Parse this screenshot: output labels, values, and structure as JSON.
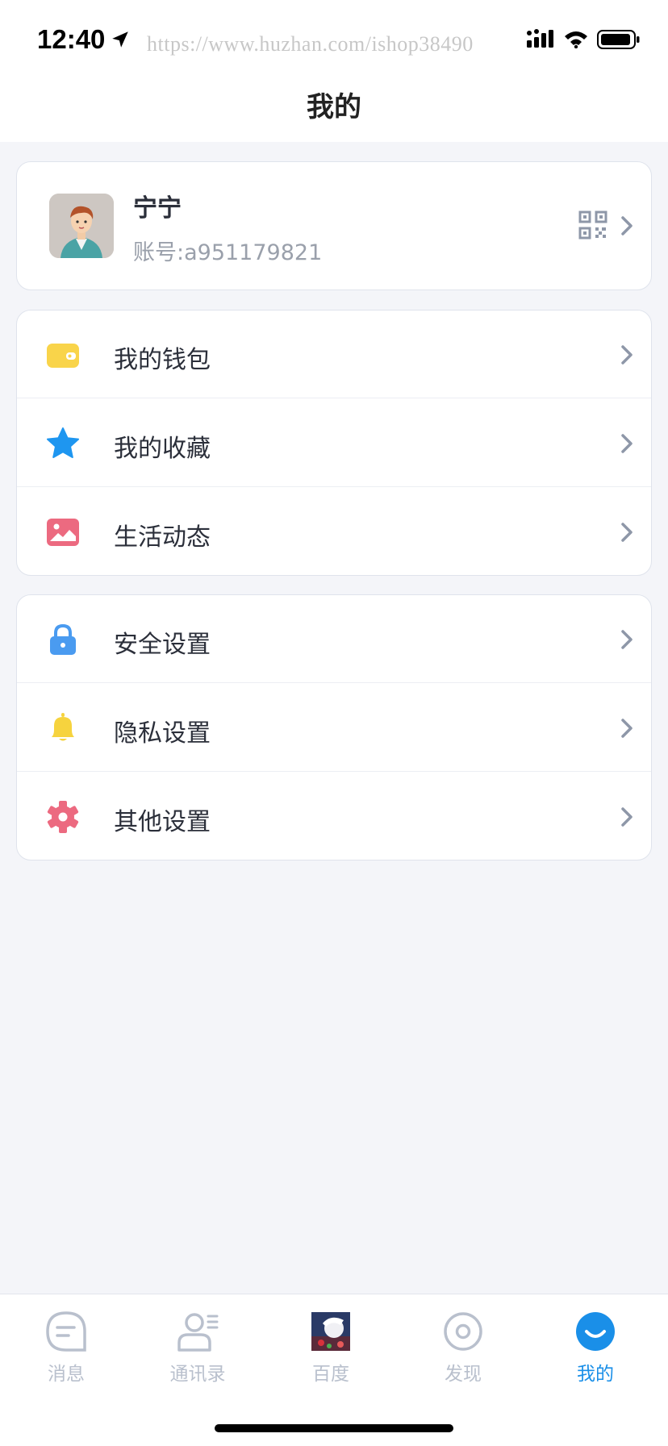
{
  "status_bar": {
    "time": "12:40",
    "watermark": "https://www.huzhan.com/ishop38490"
  },
  "header": {
    "title": "我的"
  },
  "profile": {
    "name": "宁宁",
    "account": "账号:a951179821",
    "icons": [
      "avatar",
      "qr-code-icon",
      "chevron-right-icon"
    ]
  },
  "menu_group_1": [
    {
      "label": "我的钱包",
      "icon": "wallet-icon",
      "color": "#f9d44a"
    },
    {
      "label": "我的收藏",
      "icon": "star-icon",
      "color": "#1e96f0"
    },
    {
      "label": "生活动态",
      "icon": "photo-icon",
      "color": "#ec6a80"
    }
  ],
  "menu_group_2": [
    {
      "label": "安全设置",
      "icon": "lock-icon",
      "color": "#4a9bf0"
    },
    {
      "label": "隐私设置",
      "icon": "bell-icon",
      "color": "#f6d33e"
    },
    {
      "label": "其他设置",
      "icon": "gear-icon",
      "color": "#ec6a80"
    }
  ],
  "tabbar": {
    "active": "我的",
    "active_color": "#1a8fe8",
    "inactive_color": "#b9c0cd",
    "tabs": [
      {
        "label": "消息",
        "icon": "message-icon"
      },
      {
        "label": "通讯录",
        "icon": "contacts-icon"
      },
      {
        "label": "百度",
        "icon": "baidu-thumbnail"
      },
      {
        "label": "发现",
        "icon": "discover-icon"
      },
      {
        "label": "我的",
        "icon": "me-icon"
      }
    ]
  }
}
